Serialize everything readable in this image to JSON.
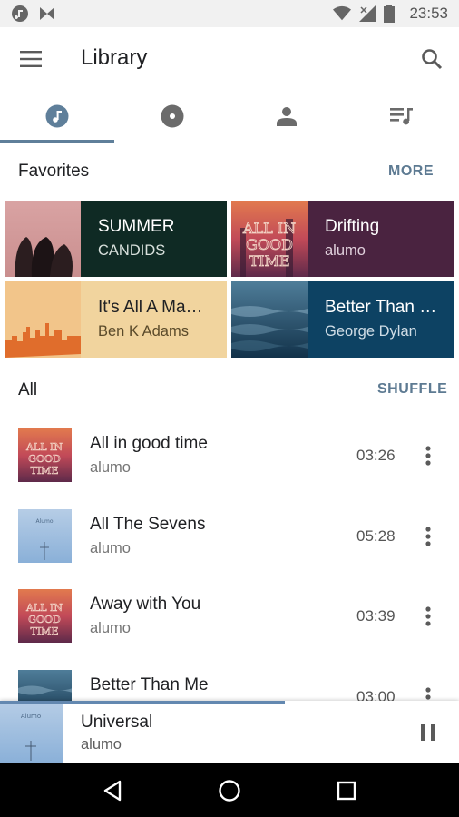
{
  "status_bar": {
    "time": "23:53",
    "icons": [
      "music-note-icon",
      "app-notification-icon",
      "wifi-icon",
      "signal-icon",
      "battery-icon"
    ]
  },
  "app_bar": {
    "title": "Library",
    "icons": [
      "menu-icon",
      "search-icon"
    ]
  },
  "tabs": [
    {
      "name": "tab-songs",
      "icon": "music-note-icon",
      "active": true
    },
    {
      "name": "tab-albums",
      "icon": "album-icon",
      "active": false
    },
    {
      "name": "tab-artists",
      "icon": "person-icon",
      "active": false
    },
    {
      "name": "tab-playlists",
      "icon": "playlist-icon",
      "active": false
    }
  ],
  "favorites": {
    "title": "Favorites",
    "more_label": "MORE",
    "items": [
      {
        "title": "SUMMER",
        "subtitle": "CANDIDS",
        "bg": "#0f2a24",
        "text": "#ffffff",
        "sub": "#d8e0dc"
      },
      {
        "title": "Drifting",
        "subtitle": "alumo",
        "bg": "#4a2340",
        "text": "#ffffff",
        "sub": "#e0d0dc"
      },
      {
        "title": "It's All A Ma…",
        "subtitle": "Ben K Adams",
        "bg": "#f1d49e",
        "text": "#202124",
        "sub": "#5a4a2a"
      },
      {
        "title": "Better Than …",
        "subtitle": "George Dylan",
        "bg": "#0d4263",
        "text": "#ffffff",
        "sub": "#d0dde6"
      }
    ]
  },
  "all": {
    "title": "All",
    "shuffle_label": "SHUFFLE"
  },
  "songs": [
    {
      "title": "All in good time",
      "artist": "alumo",
      "duration": "03:26",
      "art": "good-time"
    },
    {
      "title": "All The Sevens",
      "artist": "alumo",
      "duration": "05:28",
      "art": "alumo-blue"
    },
    {
      "title": "Away with You",
      "artist": "alumo",
      "duration": "03:39",
      "art": "good-time"
    },
    {
      "title": "Better Than Me",
      "artist": "",
      "duration": "03:00",
      "art": "ocean"
    }
  ],
  "now_playing": {
    "title": "Universal",
    "artist": "alumo",
    "progress": 0.62
  },
  "nav_bar": {
    "icons": [
      "back-icon",
      "home-icon",
      "recents-icon"
    ]
  },
  "colors": {
    "accent": "#5d7a92",
    "progress": "#6388b0"
  }
}
